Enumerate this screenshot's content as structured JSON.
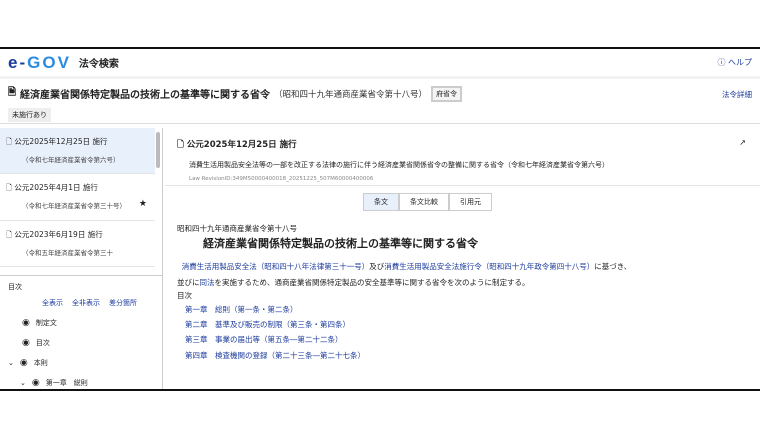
{
  "header": {
    "logo_main": "e-",
    "logo_accent": "GOV",
    "app_title": "法令検索",
    "help": "ヘルプ"
  },
  "law": {
    "title": "経済産業省関係特定製品の技術上の基準等に関する省令",
    "number": "（昭和四十九年通商産業省令第十八号）",
    "type_tag": "府省令",
    "badge": "未施行あり",
    "detail_link": "法令詳細"
  },
  "versions": [
    {
      "date": "公元2025年12月25日 施行",
      "sub": "（令和七年経済産業省令第六号）"
    },
    {
      "date": "公元2025年4月1日 施行",
      "sub": "（令和七年経済産業省令第三十号）"
    },
    {
      "date": "公元2023年6月19日 施行",
      "sub": "（令和五年経済産業省令第三十"
    }
  ],
  "toc": {
    "label": "目次",
    "links": [
      "全表示",
      "全非表示",
      "差分箇所"
    ],
    "items": [
      "制定文",
      "目次",
      "本則",
      "第一章　総則"
    ]
  },
  "revision": {
    "date": "公元2025年12月25日 施行",
    "desc": "消費生活用製品安全法等の一部を改正する法律の施行に伴う経済産業省関係省令の整備に関する省令（令和七年経済産業省令第六号）",
    "id": "Law RevisionID:349M50000400018_20251225_507M60000400006"
  },
  "tabs": [
    "条文",
    "条文比較",
    "引用元"
  ],
  "content": {
    "law_num": "昭和四十九年通商産業省令第十八号",
    "heading": "経済産業省関係特定製品の技術上の基準等に関する省令",
    "l1": "消費生活用製品安全法（昭和四十八年法律第三十一号）",
    "t1": "及び",
    "l2": "消費生活用製品安全法施行令（昭和四十九年政令第四十八号）",
    "t2": "に基づき、",
    "t3": "並びに",
    "l3": "同法",
    "t4": "を実施するため、通商産業省関係特定製品の安全基準等に関する省令を次のように制定する。",
    "toc_label": "目次",
    "chapters": [
      "第一章　総則（第一条・第二条）",
      "第二章　基準及び販売の制限（第三条・第四条）",
      "第三章　事業の届出等（第五条―第二十二条）",
      "第四章　検査機関の登録（第二十三条―第二十七条）"
    ]
  }
}
